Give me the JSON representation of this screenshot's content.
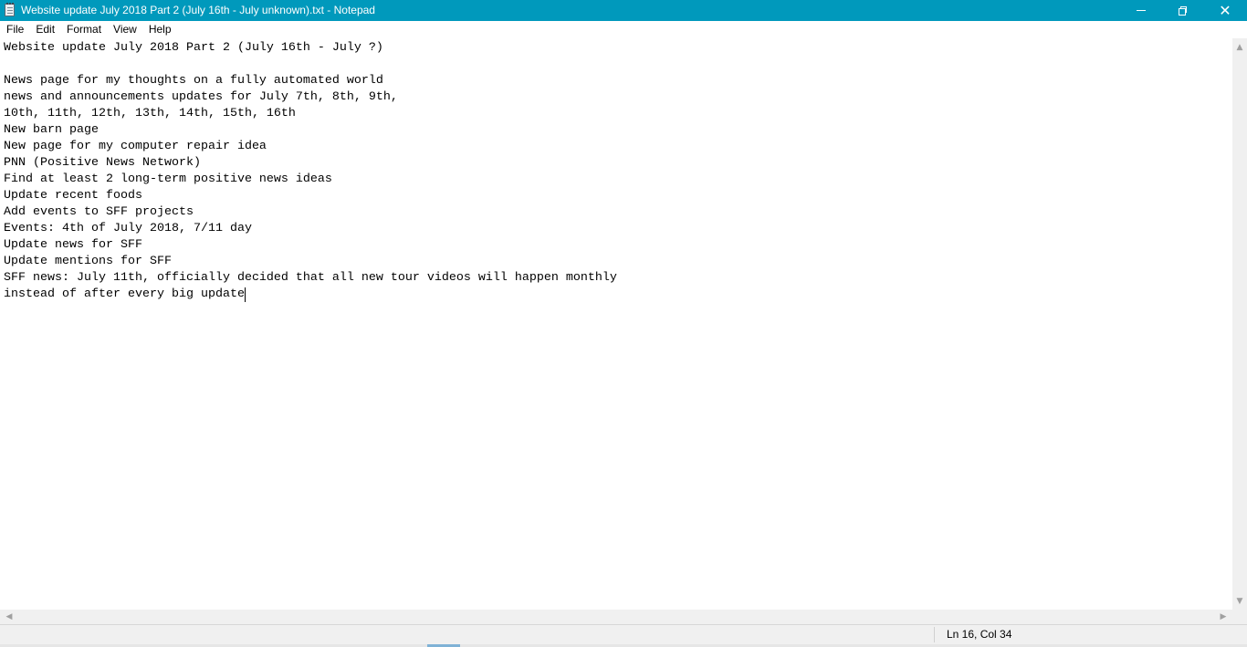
{
  "window": {
    "title": "Website update July 2018 Part 2 (July 16th - July unknown).txt - Notepad",
    "accent_color": "#0099bc",
    "icons": {
      "app": "notepad-icon",
      "minimize": "minimize-icon",
      "maximize": "restore-icon",
      "close": "close-icon"
    },
    "close_glyph": "✕"
  },
  "menu": {
    "items": [
      "File",
      "Edit",
      "Format",
      "View",
      "Help"
    ]
  },
  "editor": {
    "lines": [
      "Website update July 2018 Part 2 (July 16th - July ?)",
      "",
      "News page for my thoughts on a fully automated world",
      "news and announcements updates for July 7th, 8th, 9th,",
      "10th, 11th, 12th, 13th, 14th, 15th, 16th",
      "New barn page",
      "New page for my computer repair idea",
      "PNN (Positive News Network)",
      "Find at least 2 long-term positive news ideas",
      "Update recent foods",
      "Add events to SFF projects",
      "Events: 4th of July 2018, 7/11 day",
      "Update news for SFF",
      "Update mentions for SFF",
      "SFF news: July 11th, officially decided that all new tour videos will happen monthly",
      "instead of after every big update"
    ]
  },
  "scrollbars": {
    "up": "▲",
    "down": "▼",
    "left": "◀",
    "right": "▶"
  },
  "status": {
    "position": "Ln 16, Col 34"
  }
}
